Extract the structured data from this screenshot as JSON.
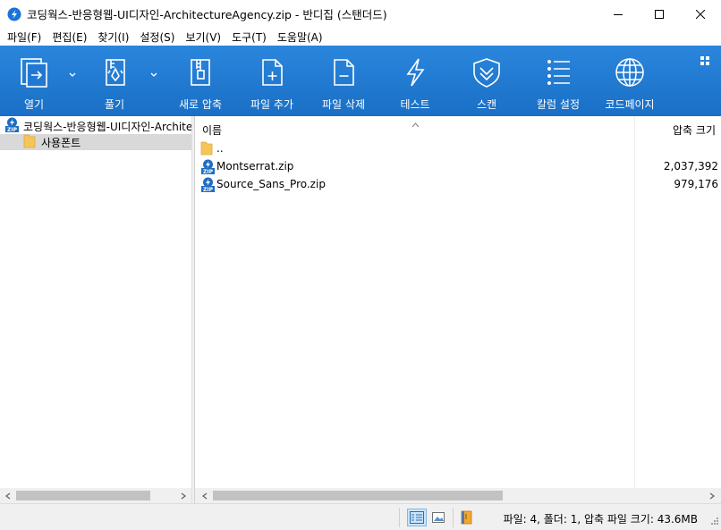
{
  "window": {
    "title": "코딩웍스-반응형웹-UI디자인-ArchitectureAgency.zip - 반디집 (스탠더드)",
    "controls": [
      "minimize-icon",
      "maximize-icon",
      "close-icon"
    ]
  },
  "menu": {
    "items": [
      "파일(F)",
      "편집(E)",
      "찾기(I)",
      "설정(S)",
      "보기(V)",
      "도구(T)",
      "도움말(A)"
    ]
  },
  "toolbar": {
    "buttons": [
      {
        "label": "열기",
        "icon": "open-icon"
      },
      {
        "label": "풀기",
        "icon": "extract-icon"
      },
      {
        "label": "새로 압축",
        "icon": "new-archive-icon"
      },
      {
        "label": "파일 추가",
        "icon": "add-file-icon"
      },
      {
        "label": "파일 삭제",
        "icon": "delete-file-icon"
      },
      {
        "label": "테스트",
        "icon": "test-lightning-icon"
      },
      {
        "label": "스캔",
        "icon": "scan-shield-icon"
      },
      {
        "label": "칼럼 설정",
        "icon": "columns-icon"
      },
      {
        "label": "코드페이지",
        "icon": "codepage-globe-icon"
      }
    ]
  },
  "tree": {
    "root": "코딩웍스-반응형웹-UI디자인-ArchitectureAgency.zip",
    "children": [
      "사용폰트"
    ]
  },
  "list": {
    "columns": {
      "name": "이름",
      "size": "압축 크기"
    },
    "rows": [
      {
        "name": "..",
        "size": "",
        "icon": "folder-icon"
      },
      {
        "name": "Montserrat.zip",
        "size": "2,037,392",
        "icon": "zip-icon"
      },
      {
        "name": "Source_Sans_Pro.zip",
        "size": "979,176",
        "icon": "zip-icon"
      }
    ]
  },
  "status": {
    "text": "파일: 4, 폴더: 1, 압축 파일 크기: 43.6MB"
  },
  "colors": {
    "toolbar": "#1a6fc6",
    "selection": "#d9d9d9",
    "folder": "#f6c55a",
    "zip_blue": "#1c6ec2"
  }
}
